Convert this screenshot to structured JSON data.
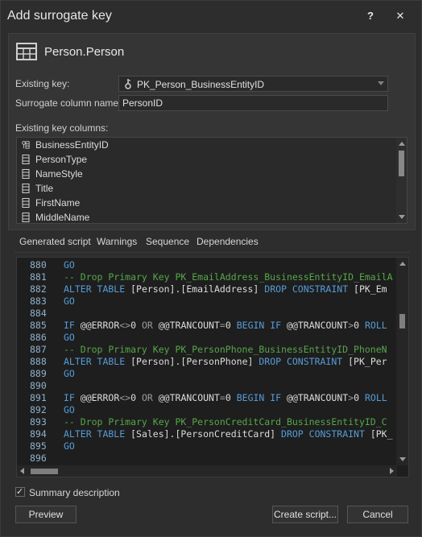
{
  "window": {
    "title": "Add surrogate key",
    "help_label": "?",
    "close_label": "✕"
  },
  "header": {
    "title": "Person.Person",
    "icon": "table-icon"
  },
  "form": {
    "existing_key_label": "Existing key:",
    "existing_key_value": "PK_Person_BusinessEntityID",
    "surrogate_label": "Surrogate column name:",
    "surrogate_value": "PersonID",
    "columns_label": "Existing key columns:"
  },
  "columns": [
    {
      "name": "BusinessEntityID",
      "icon": "key-column-icon"
    },
    {
      "name": "PersonType",
      "icon": "column-icon"
    },
    {
      "name": "NameStyle",
      "icon": "column-icon"
    },
    {
      "name": "Title",
      "icon": "column-icon"
    },
    {
      "name": "FirstName",
      "icon": "column-icon"
    },
    {
      "name": "MiddleName",
      "icon": "column-icon"
    }
  ],
  "tabs": [
    "Generated script",
    "Warnings",
    "Sequence",
    "Dependencies"
  ],
  "script_lines": [
    {
      "n": "880",
      "t": [
        [
          "kw",
          "GO"
        ]
      ]
    },
    {
      "n": "881",
      "t": [
        [
          "cm",
          "-- Drop Primary Key PK_EmailAddress_BusinessEntityID_EmailA"
        ]
      ]
    },
    {
      "n": "882",
      "t": [
        [
          "kw",
          "ALTER TABLE "
        ],
        [
          "tx",
          "[Person].[EmailAddress] "
        ],
        [
          "kw",
          "DROP CONSTRAINT "
        ],
        [
          "tx",
          "[PK_Em"
        ]
      ]
    },
    {
      "n": "883",
      "t": [
        [
          "kw",
          "GO"
        ]
      ]
    },
    {
      "n": "884",
      "t": []
    },
    {
      "n": "885",
      "t": [
        [
          "kw",
          "IF "
        ],
        [
          "tx",
          "@@ERROR"
        ],
        [
          "op",
          "<>"
        ],
        [
          "tx",
          "0 "
        ],
        [
          "op",
          "OR "
        ],
        [
          "tx",
          "@@TRANCOUNT"
        ],
        [
          "op",
          "="
        ],
        [
          "tx",
          "0 "
        ],
        [
          "kw",
          "BEGIN IF "
        ],
        [
          "tx",
          "@@TRANCOUNT"
        ],
        [
          "op",
          ">"
        ],
        [
          "tx",
          "0 "
        ],
        [
          "kw",
          "ROLL"
        ]
      ]
    },
    {
      "n": "886",
      "t": [
        [
          "kw",
          "GO"
        ]
      ]
    },
    {
      "n": "887",
      "t": [
        [
          "cm",
          "-- Drop Primary Key PK_PersonPhone_BusinessEntityID_PhoneN"
        ]
      ]
    },
    {
      "n": "888",
      "t": [
        [
          "kw",
          "ALTER TABLE "
        ],
        [
          "tx",
          "[Person].[PersonPhone] "
        ],
        [
          "kw",
          "DROP CONSTRAINT "
        ],
        [
          "tx",
          "[PK_Per"
        ]
      ]
    },
    {
      "n": "889",
      "t": [
        [
          "kw",
          "GO"
        ]
      ]
    },
    {
      "n": "890",
      "t": []
    },
    {
      "n": "891",
      "t": [
        [
          "kw",
          "IF "
        ],
        [
          "tx",
          "@@ERROR"
        ],
        [
          "op",
          "<>"
        ],
        [
          "tx",
          "0 "
        ],
        [
          "op",
          "OR "
        ],
        [
          "tx",
          "@@TRANCOUNT"
        ],
        [
          "op",
          "="
        ],
        [
          "tx",
          "0 "
        ],
        [
          "kw",
          "BEGIN IF "
        ],
        [
          "tx",
          "@@TRANCOUNT"
        ],
        [
          "op",
          ">"
        ],
        [
          "tx",
          "0 "
        ],
        [
          "kw",
          "ROLL"
        ]
      ]
    },
    {
      "n": "892",
      "t": [
        [
          "kw",
          "GO"
        ]
      ]
    },
    {
      "n": "893",
      "t": [
        [
          "cm",
          "-- Drop Primary Key PK_PersonCreditCard_BusinessEntityID_C"
        ]
      ]
    },
    {
      "n": "894",
      "t": [
        [
          "kw",
          "ALTER TABLE "
        ],
        [
          "tx",
          "[Sales].[PersonCreditCard] "
        ],
        [
          "kw",
          "DROP CONSTRAINT "
        ],
        [
          "tx",
          "[PK_"
        ]
      ]
    },
    {
      "n": "895",
      "t": [
        [
          "kw",
          "GO"
        ]
      ]
    },
    {
      "n": "896",
      "t": []
    }
  ],
  "summary_label": "Summary description",
  "buttons": {
    "preview": "Preview",
    "create_script": "Create script...",
    "cancel": "Cancel"
  },
  "colors": {
    "keyword": "#569cd6",
    "comment": "#57a64a",
    "line_number": "#8fb1cc",
    "background": "#2d2d2d"
  }
}
